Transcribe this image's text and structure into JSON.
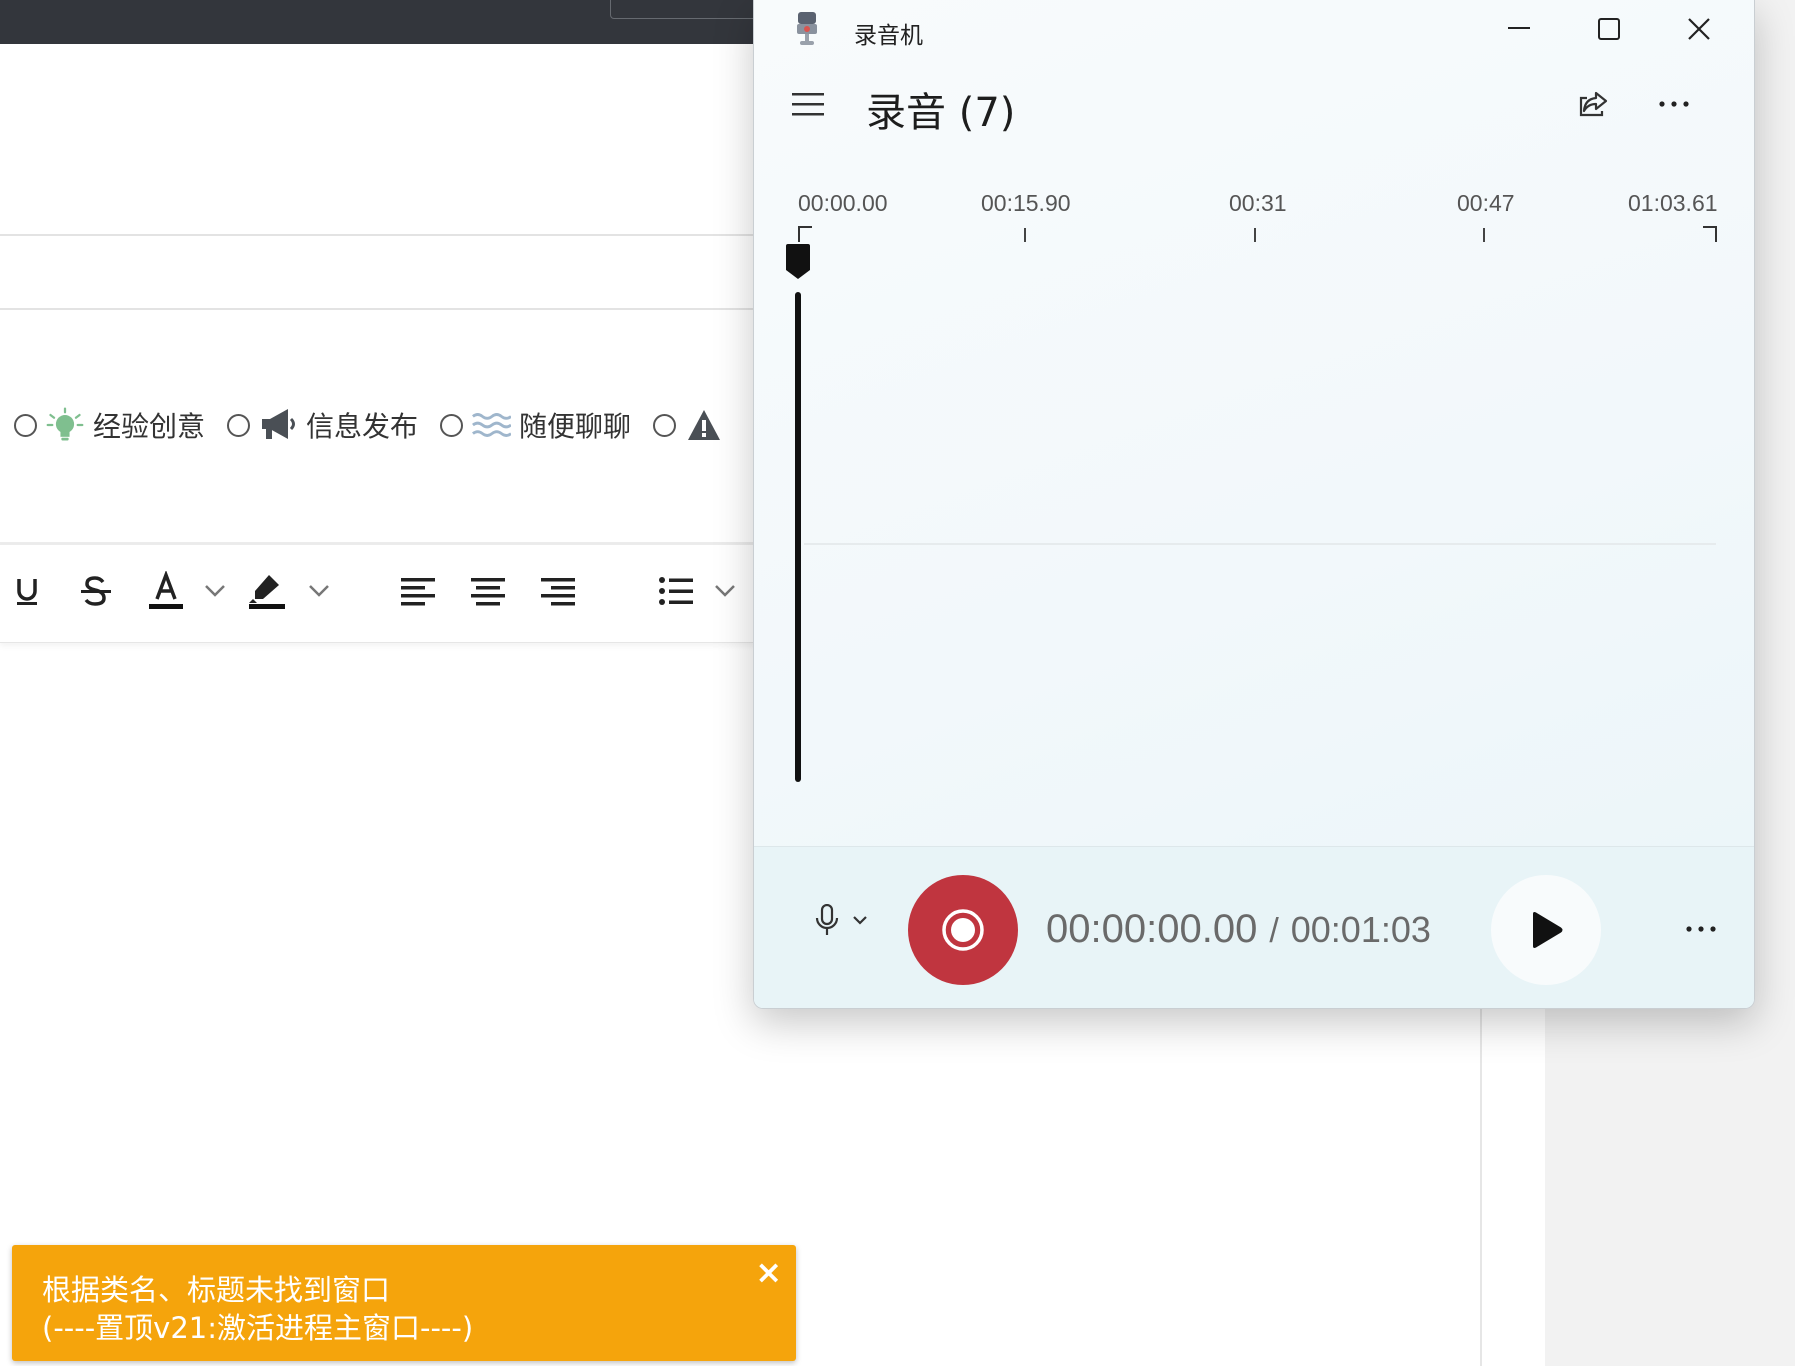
{
  "background": {
    "categories": [
      {
        "label": "经验创意",
        "icon": "lightbulb-icon"
      },
      {
        "label": "信息发布",
        "icon": "megaphone-icon"
      },
      {
        "label": "随便聊聊",
        "icon": "waves-icon"
      },
      {
        "label": "",
        "icon": "warning-icon"
      }
    ],
    "toolbar": [
      "underline-icon",
      "strikethrough-icon",
      "font-color-icon",
      "highlight-icon",
      "align-left-icon",
      "align-center-icon",
      "align-right-icon",
      "bullet-list-icon"
    ]
  },
  "toast": {
    "line1": "根据类名、标题未找到窗口",
    "line2": "(----置顶v21:激活进程主窗口----)",
    "close": "×"
  },
  "recorder": {
    "app_title": "录音机",
    "title": "录音 (7)",
    "timeline": {
      "ticks": [
        "00:00.00",
        "00:15.90",
        "00:31",
        "00:47",
        "01:03.61"
      ]
    },
    "current_time": "00:00:00.00",
    "separator": "/",
    "total_time": "00:01:03",
    "accent_color": "#c0353f"
  }
}
